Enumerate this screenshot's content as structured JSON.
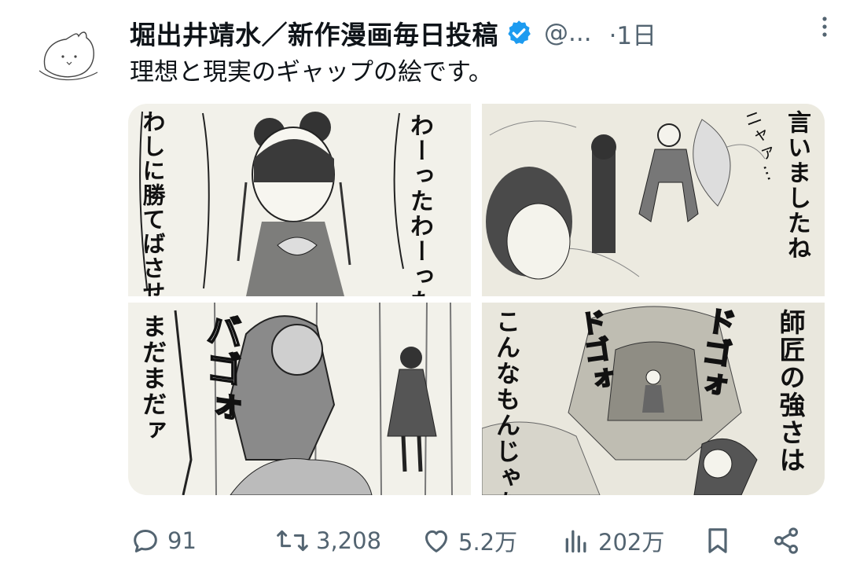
{
  "tweet": {
    "author_name": "堀出井靖水／新作漫画毎日投稿",
    "handle": "@...",
    "time": "·1日",
    "text": "理想と現実のギャップの絵です。",
    "verified_color": "#1d9bf0"
  },
  "panels": [
    {
      "id": "top-left",
      "texts": [
        "わーったわーった",
        "わしに勝てばさせてやる"
      ]
    },
    {
      "id": "top-right",
      "texts": [
        "言いましたね",
        "ニャァ…"
      ]
    },
    {
      "id": "bottom-left",
      "texts": [
        "まだまだァ",
        "バゴォ"
      ]
    },
    {
      "id": "bottom-right",
      "texts": [
        "師匠の強さは",
        "こんなもんじゃないッ",
        "ドゴォ",
        "ドゴォ"
      ]
    }
  ],
  "actions": {
    "reply_count": "91",
    "retweet_count": "3,208",
    "like_count": "5.2万",
    "view_count": "202万"
  },
  "icons": [
    "verified-badge-icon",
    "more-icon",
    "reply-icon",
    "retweet-icon",
    "like-icon",
    "views-icon",
    "bookmark-icon",
    "share-icon"
  ]
}
